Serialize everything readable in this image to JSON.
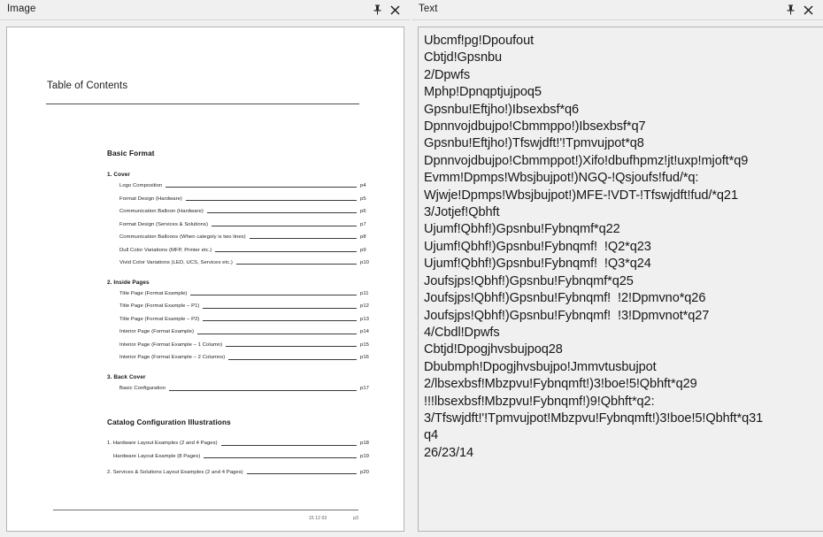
{
  "panels": {
    "image": {
      "title": "Image",
      "pin_icon": "pin-icon",
      "close_icon": "close-icon"
    },
    "text": {
      "title": "Text",
      "pin_icon": "pin-icon",
      "close_icon": "close-icon"
    }
  },
  "document": {
    "title": "Table of Contents",
    "sections": [
      {
        "heading": "Basic Format",
        "level": 1,
        "groups": [
          {
            "heading": "1. Cover",
            "entries": [
              {
                "label": "Logo Composition",
                "page": "p4"
              },
              {
                "label": "Format Design (Hardware)",
                "page": "p5"
              },
              {
                "label": "Communication Balloon (Hardware)",
                "page": "p6"
              },
              {
                "label": "Format Design (Services & Solutions)",
                "page": "p7"
              },
              {
                "label": "Communication Balloons (When categoly is two lines)",
                "page": "p8"
              },
              {
                "label": "Dull Color Variations (MFP, Printer etc.)",
                "page": "p9"
              },
              {
                "label": "Vivid Color Variations (LED, UCS, Services etc.)",
                "page": "p10"
              }
            ]
          },
          {
            "heading": "2. Inside Pages",
            "entries": [
              {
                "label": "Title Page (Format Example)",
                "page": "p11"
              },
              {
                "label": "Title Page (Format Example – P1)",
                "page": "p12"
              },
              {
                "label": "Title Page (Format Example – P2)",
                "page": "p13"
              },
              {
                "label": "Interior Page (Format Example)",
                "page": "p14"
              },
              {
                "label": "Interior Page (Format Example – 1 Column)",
                "page": "p15"
              },
              {
                "label": "Interior Page (Format Example – 2 Columns)",
                "page": "p16"
              }
            ]
          },
          {
            "heading": "3. Back Cover",
            "entries": [
              {
                "label": "Basic Configuration",
                "page": "p17"
              }
            ]
          }
        ]
      },
      {
        "heading": "Catalog Configuration Illustrations",
        "level": 1,
        "groups": [
          {
            "heading": "",
            "entries": [
              {
                "label": "1. Hardware Layout Examples (2 and 4 Pages)",
                "page": "p18",
                "indent": "none"
              },
              {
                "label": "Hardware Layout Example (8 Pages)",
                "page": "p19",
                "indent": "small"
              },
              {
                "label": "2. Services & Solutions Layout Examples (2 and 4 Pages)",
                "page": "p20",
                "indent": "none"
              }
            ]
          }
        ]
      }
    ],
    "footer": {
      "date": "15 12 03",
      "page": "p3"
    }
  },
  "text_content": {
    "lines": [
      "Ubcmf!pg!Dpoufout",
      "Cbtjd!Gpsnbu",
      "2/Dpwfs",
      "Mphp!Dpnqptjujpoq5",
      "Gpsnbu!Eftjho!)Ibsexbsf*q6",
      "Dpnnvojdbujpo!Cbmmppo!)Ibsexbsf*q7",
      "Gpsnbu!Eftjho!)Tfswjdft!'!Tpmvujpot*q8",
      "Dpnnvojdbujpo!Cbmmppot!)Xifo!dbufhpmz!jt!uxp!mjoft*q9",
      "Evmm!Dpmps!Wbsjbujpot!)NGQ-!Qsjoufs!fud/*q:",
      "Wjwje!Dpmps!Wbsjbujpot!)MFE-!VDT-!Tfswjdft!fud/*q21",
      "3/Jotjef!Qbhft",
      "Ujumf!Qbhf!)Gpsnbu!Fybnqmf*q22",
      "Ujumf!Qbhf!)Gpsnbu!Fybnqmf!  !Q2*q23",
      "Ujumf!Qbhf!)Gpsnbu!Fybnqmf!  !Q3*q24",
      "Joufsjps!Qbhf!)Gpsnbu!Fybnqmf*q25",
      "Joufsjps!Qbhf!)Gpsnbu!Fybnqmf!  !2!Dpmvno*q26",
      "Joufsjps!Qbhf!)Gpsnbu!Fybnqmf!  !3!Dpmvnot*q27",
      "4/Cbdl!Dpwfs",
      "Cbtjd!Dpogjhvsbujpoq28",
      "Dbubmph!Dpogjhvsbujpo!Jmmvtusbujpot",
      "2/lbsexbsf!Mbzpvu!Fybnqmft!)3!boe!5!Qbhft*q29",
      "!!!lbsexbsf!Mbzpvu!Fybnqmf!)9!Qbhft*q2:",
      "3/Tfswjdft!'!Tpmvujpot!Mbzpvu!Fybnqmft!)3!boe!5!Qbhft*q31",
      "q4",
      "26/23/14"
    ]
  }
}
